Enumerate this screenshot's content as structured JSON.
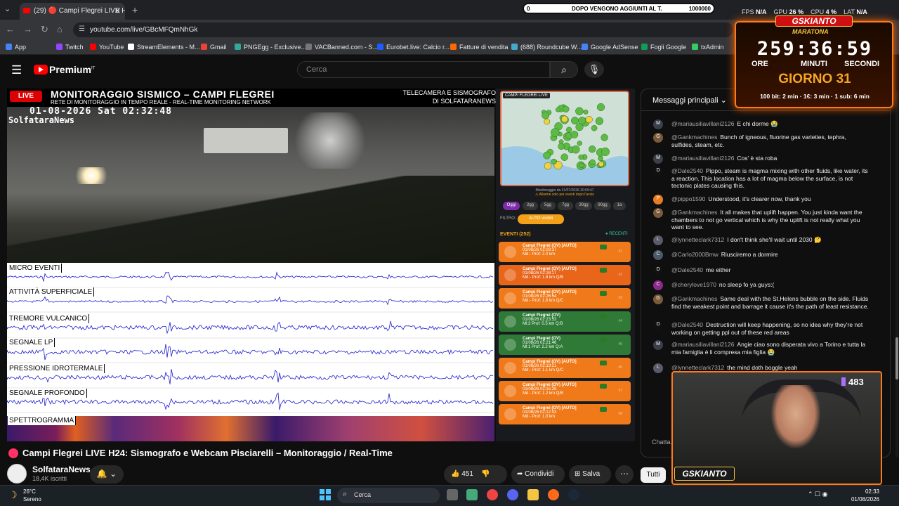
{
  "browser": {
    "tab_title": "(29) 🔴 Campi Flegrei LIVE H24",
    "url": "youtube.com/live/GBcMFQmNhGk",
    "bookmarks": [
      "App",
      "Twitch",
      "YouTube",
      "StreamElements - M...",
      "Gmail",
      "PNGEgg - Exclusive...",
      "VACBanned.com - S...",
      "Eurobet.live: Calcio r...",
      "Fatture di vendita",
      "(688) Roundcube W...",
      "Google AdSense",
      "Fogli Google",
      "txAdmin"
    ]
  },
  "youtube": {
    "brand": "Premium",
    "brand_region": "IT",
    "search_placeholder": "Cerca"
  },
  "video": {
    "live_badge": "LIVE",
    "overlay_title": "MONITORAGGIO SISMICO – CAMPI FLEGREI",
    "overlay_subtitle": "RETE DI MONITORAGGIO IN TEMPO REALE - REAL-TIME MONITORING NETWORK",
    "overlay_right1": "TELECAMERA E SISMOGRAFO",
    "overlay_right2": "DI SOLFATARANEWS",
    "timestamp": "01-08-2026 Sat 02:32:48",
    "station": "SolfataraNews",
    "channels": [
      "MICRO EVENTI",
      "ATTIVITÀ SUPERFICIALE",
      "TREMORE VULCANICO",
      "SEGNALE LP",
      "PRESSIONE IDROTERMALE",
      "SEGNALE PROFONDO",
      "SPETTROGRAMMA"
    ]
  },
  "map_panel": {
    "map_label": "CAMPI FLEGREI LIVE",
    "caption": "Monitoraggio da 31/07/2026 20:59:47",
    "caption2": "⚠ Allarme solo per eventi dopo l'avvio",
    "filters": [
      "Oggi",
      "2gg",
      "5gg",
      "7gg",
      "30gg",
      "90gg",
      "1a"
    ],
    "filter_label": "FILTRO:",
    "auto_label": "AUTO visibili",
    "events_header": "EVENTI (252)",
    "recent_label": "● RECENTI",
    "events": [
      {
        "title": "Campi Flegrei (OV) [AUTO]",
        "date": "01/08/26 02:29:37",
        "info": "Md:- Prof: 2.0 km",
        "color": "#f07a1a",
        "num": "#1"
      },
      {
        "title": "Campi Flegrei (OV) [AUTO]",
        "date": "01/08/26 02:28:17",
        "info": "Md:- Prof: 1.8 km Q/B",
        "color": "#e8651a",
        "num": "#2"
      },
      {
        "title": "Campi Flegrei (OV) [AUTO]",
        "date": "01/08/26 02:26:54",
        "info": "Md:- Prof: 1.6 km Q/C",
        "color": "#f07a1a",
        "num": "#3"
      },
      {
        "title": "Campi Flegrei (OV)",
        "date": "01/08/26 02:23:53",
        "info": "Ml:3 Prof: 0.5 km Q:B",
        "color": "#2e7a36",
        "num": "#4"
      },
      {
        "title": "Campi Flegrei (OV)",
        "date": "01/08/26 02:21:46",
        "info": "Ml:1 Prof: 2.2 km Q:A",
        "color": "#2e7a36",
        "num": "#5"
      },
      {
        "title": "Campi Flegrei (OV) [AUTO]",
        "date": "01/08/26 02:19:21",
        "info": "Md:- Prof: 1.1 km Q/C",
        "color": "#f07a1a",
        "num": "#6"
      },
      {
        "title": "Campi Flegrei (OV) [AUTO]",
        "date": "01/08/26 02:15:28",
        "info": "Md:- Prof: 1.2 km Q/B",
        "color": "#f07a1a",
        "num": "#7"
      },
      {
        "title": "Campi Flegrei (OV) [AUTO]",
        "date": "01/08/26 02:12:03",
        "info": "Md:- Prof: 1.0 km",
        "color": "#f07a1a",
        "num": "#8"
      }
    ]
  },
  "video_info": {
    "title": "Campi Flegrei LIVE H24: Sismografo e Webcam Pisciarelli – Monitoraggio / Real-Time",
    "channel": "SolfataraNews",
    "subscribers": "18,4K iscritti",
    "likes": "451",
    "share": "Condividi",
    "save": "Salva"
  },
  "chat": {
    "header": "Messaggi principali",
    "input_placeholder": "Chatta...",
    "filter_chip": "Tutti",
    "messages": [
      {
        "author": "@mariausiliavillani2126",
        "text": "E chi dorme 😭",
        "avatar": "M",
        "avcolor": "#3a3f4a"
      },
      {
        "author": "@Gankmachines",
        "text": "Bunch of igneous, fluorine gas varieties, tephra, sulfides, steam, etc.",
        "avatar": "G",
        "avcolor": "#7a5a3a"
      },
      {
        "author": "@mariausiliavillani2126",
        "text": "Cos' è sta roba",
        "avatar": "M",
        "avcolor": "#3a3f4a"
      },
      {
        "author": "@Dale2540",
        "text": "Pippo, steam is magma mixing with other fluids, like water, its a reaction. This location has a lot of magma below the surface, is not tectonic plates causing this.",
        "avatar": "D",
        "avcolor": "#111"
      },
      {
        "author": "@pippo1590",
        "text": "Understood, it's clearer now, thank you",
        "avatar": "P",
        "avcolor": "#e67e22"
      },
      {
        "author": "@Gankmachines",
        "text": "It all makes that uplift happen. You just kinda want the chambers to not go vertical which is why the uplift is not really what you want to see.",
        "avatar": "G",
        "avcolor": "#7a5a3a"
      },
      {
        "author": "@lynnetteclark7312",
        "text": "I don't think she'll wait until 2030 🤔",
        "avatar": "L",
        "avcolor": "#5a5a6a"
      },
      {
        "author": "@Carlo2000Bmw",
        "text": "Riusciremo a dormire",
        "avatar": "C",
        "avcolor": "#4a5a6a"
      },
      {
        "author": "@Dale2540",
        "text": "me either",
        "avatar": "D",
        "avcolor": "#111"
      },
      {
        "author": "@cherylove1970",
        "text": "no sleep fo ya guys:(",
        "avatar": "C",
        "avcolor": "#8a2a8a"
      },
      {
        "author": "@Gankmachines",
        "text": "Same deal with the St.Helens bubble on the side. Fluids find the weakest point and barrage it cause it's the path of least resistance.",
        "avatar": "G",
        "avcolor": "#7a5a3a"
      },
      {
        "author": "@Dale2540",
        "text": "Destruction will keep happening, so no idea why they're not working on getting ppl out of these red areas",
        "avatar": "D",
        "avcolor": "#111"
      },
      {
        "author": "@mariausiliavillani2126",
        "text": "Angie ciao sono disperata vivo a Torino e tutta la mia famiglia è li compresa mia figlia 😭",
        "avatar": "M",
        "avcolor": "#3a3f4a"
      },
      {
        "author": "@lynnetteclark7312",
        "text": "the mind doth boggle yeah",
        "avatar": "L",
        "avcolor": "#5a5a6a"
      }
    ]
  },
  "overlay": {
    "progress_left": "0",
    "progress_text": "DOPO VENGONO AGGIUNTI AL T.",
    "progress_right": "1000000",
    "fps_label": "FPS",
    "fps": "N/A",
    "gpu_label": "GPU",
    "gpu": "26 %",
    "cpu_label": "CPU",
    "cpu": "4 %",
    "lat_label": "LAT",
    "lat": "N/A",
    "brand": "GSKIANTO",
    "subtitle": "MARATONA",
    "hours": "259",
    "minutes": "36",
    "seconds": "59",
    "label_h": "ORE",
    "label_m": "MINUTI",
    "label_s": "SECONDI",
    "day": "GIORNO 31",
    "bits": "100 bit: 2 min · 1€: 3 min · 1 sub: 6 min",
    "viewers": "483",
    "webcam_brand": "GSKIANTO"
  },
  "taskbar": {
    "temp": "26°C",
    "weather": "Sereno",
    "search": "Cerca",
    "time": "02:33",
    "date": "01/08/2026"
  }
}
